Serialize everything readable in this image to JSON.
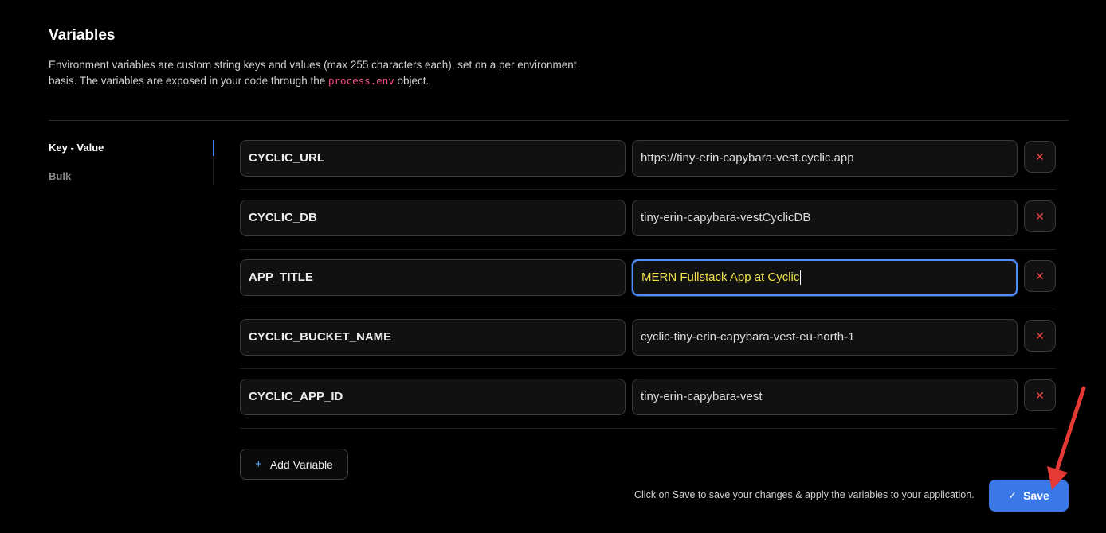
{
  "section": {
    "title": "Variables",
    "description_pre": "Environment variables are custom string keys and values (max 255 characters each), set on a per environment basis. The variables are exposed in your code through the ",
    "description_code": "process.env",
    "description_post": " object."
  },
  "nav": {
    "items": [
      {
        "label": "Key - Value",
        "active": true
      },
      {
        "label": "Bulk",
        "active": false
      }
    ],
    "accent": "#3b82f6"
  },
  "variables": [
    {
      "key": "CYCLIC_URL",
      "value": "https://tiny-erin-capybara-vest.cyclic.app"
    },
    {
      "key": "CYCLIC_DB",
      "value": "tiny-erin-capybara-vestCyclicDB"
    },
    {
      "key": "APP_TITLE",
      "value": "MERN Fullstack App at Cyclic",
      "focused": true
    },
    {
      "key": "CYCLIC_BUCKET_NAME",
      "value": "cyclic-tiny-erin-capybara-vest-eu-north-1"
    },
    {
      "key": "CYCLIC_APP_ID",
      "value": "tiny-erin-capybara-vest"
    }
  ],
  "delete_icon": "close-icon",
  "actions": {
    "add_label": "Add Variable",
    "save_hint": "Click on Save to save your changes & apply the variables to your application.",
    "save_label": "Save"
  },
  "colors": {
    "save_button": "#3b78e7",
    "delete_icon": "#ef4444",
    "annotation_arrow": "#e53935"
  }
}
